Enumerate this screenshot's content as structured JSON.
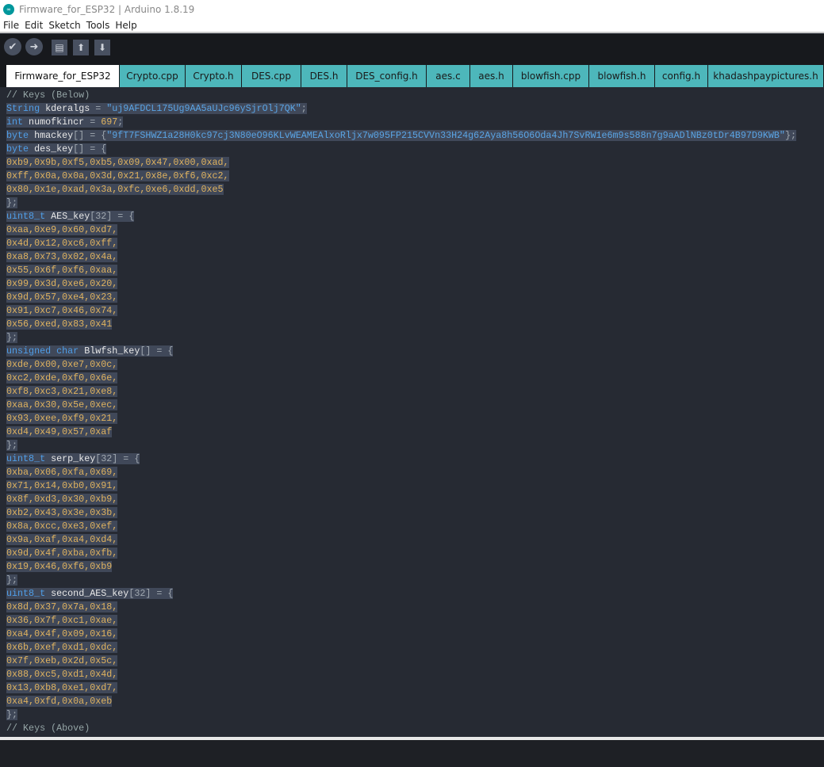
{
  "window": {
    "title": "Firmware_for_ESP32 | Arduino 1.8.19",
    "logo": "arduino-logo"
  },
  "menu": [
    "File",
    "Edit",
    "Sketch",
    "Tools",
    "Help"
  ],
  "toolbar": {
    "verify": "✔",
    "upload": "➜",
    "new": "▤",
    "open": "⬆",
    "save": "⬇"
  },
  "tabs": [
    "Firmware_for_ESP32",
    "Crypto.cpp",
    "Crypto.h",
    "DES.cpp",
    "DES.h",
    "DES_config.h",
    "aes.c",
    "aes.h",
    "blowfish.cpp",
    "blowfish.h",
    "config.h",
    "khadashpaypictures.h"
  ],
  "active_tab": 0,
  "colors": {
    "tab": "#4db7bb",
    "editor_bg": "#262a33",
    "selection": "#404859",
    "keyword": "#4f9ee8",
    "number": "#e0b35f",
    "string": "#5aa5e6"
  },
  "code": [
    {
      "sel": false,
      "t": [
        [
          "cm",
          "// Keys (Below)"
        ]
      ]
    },
    {
      "sel": true,
      "t": [
        [
          "kw",
          "String"
        ],
        [
          "id",
          " kderalgs "
        ],
        [
          "op",
          "= "
        ],
        [
          "str",
          "\"uj9AFDCL175Ug9AA5aUJc96ySjrOlj7QK\""
        ],
        [
          "op",
          ";"
        ]
      ]
    },
    {
      "sel": true,
      "t": [
        [
          "kw",
          "int"
        ],
        [
          "id",
          " numofkincr "
        ],
        [
          "op",
          "= "
        ],
        [
          "num",
          "697"
        ],
        [
          "op",
          ";"
        ]
      ]
    },
    {
      "sel": true,
      "t": [
        [
          "kw",
          "byte"
        ],
        [
          "id",
          " hmackey"
        ],
        [
          "op",
          "[] = {"
        ],
        [
          "str",
          "\"9fT7FSHWZ1a28H0kc97cj3N80eO96KLvWEAMEAlxoRljx7w095FP215CVVn33H24g62Aya8h56O6Oda4Jh7SvRW1e6m9s588n7g9aADlNBz0tDr4B97D9KWB\""
        ],
        [
          "op",
          "};"
        ]
      ]
    },
    {
      "sel": true,
      "t": [
        [
          "kw",
          "byte"
        ],
        [
          "id",
          " des_key"
        ],
        [
          "op",
          "[] = {"
        ]
      ]
    },
    {
      "sel": true,
      "t": [
        [
          "num",
          "0xb9,0x9b,0xf5,0xb5,0x09,0x47,0x00,0xad,"
        ]
      ]
    },
    {
      "sel": true,
      "t": [
        [
          "num",
          "0xff,0x0a,0x0a,0x3d,0x21,0x8e,0xf6,0xc2,"
        ]
      ]
    },
    {
      "sel": true,
      "t": [
        [
          "num",
          "0x80,0x1e,0xad,0x3a,0xfc,0xe6,0xdd,0xe5"
        ]
      ]
    },
    {
      "sel": true,
      "t": [
        [
          "op",
          "};"
        ]
      ]
    },
    {
      "sel": true,
      "t": [
        [
          "kw",
          "uint8_t"
        ],
        [
          "id",
          " AES_key"
        ],
        [
          "op",
          "[32] = {"
        ]
      ]
    },
    {
      "sel": true,
      "t": [
        [
          "num",
          "0xaa,0xe9,0x60,0xd7,"
        ]
      ]
    },
    {
      "sel": true,
      "t": [
        [
          "num",
          "0x4d,0x12,0xc6,0xff,"
        ]
      ]
    },
    {
      "sel": true,
      "t": [
        [
          "num",
          "0xa8,0x73,0x02,0x4a,"
        ]
      ]
    },
    {
      "sel": true,
      "t": [
        [
          "num",
          "0x55,0x6f,0xf6,0xaa,"
        ]
      ]
    },
    {
      "sel": true,
      "t": [
        [
          "num",
          "0x99,0x3d,0xe6,0x20,"
        ]
      ]
    },
    {
      "sel": true,
      "t": [
        [
          "num",
          "0x9d,0x57,0xe4,0x23,"
        ]
      ]
    },
    {
      "sel": true,
      "t": [
        [
          "num",
          "0x91,0xc7,0x46,0x74,"
        ]
      ]
    },
    {
      "sel": true,
      "t": [
        [
          "num",
          "0x56,0xed,0x83,0x41"
        ]
      ]
    },
    {
      "sel": true,
      "t": [
        [
          "op",
          "};"
        ]
      ]
    },
    {
      "sel": true,
      "t": [
        [
          "kw",
          "unsigned char"
        ],
        [
          "id",
          " Blwfsh_key"
        ],
        [
          "op",
          "[] = {"
        ]
      ]
    },
    {
      "sel": true,
      "t": [
        [
          "num",
          "0xde,0x00,0xe7,0x0c,"
        ]
      ]
    },
    {
      "sel": true,
      "t": [
        [
          "num",
          "0xc2,0xde,0xf0,0x6e,"
        ]
      ]
    },
    {
      "sel": true,
      "t": [
        [
          "num",
          "0xf8,0xc3,0x21,0xe8,"
        ]
      ]
    },
    {
      "sel": true,
      "t": [
        [
          "num",
          "0xaa,0x30,0x5e,0xec,"
        ]
      ]
    },
    {
      "sel": true,
      "t": [
        [
          "num",
          "0x93,0xee,0xf9,0x21,"
        ]
      ]
    },
    {
      "sel": true,
      "t": [
        [
          "num",
          "0xd4,0x49,0x57,0xaf"
        ]
      ]
    },
    {
      "sel": true,
      "t": [
        [
          "op",
          "};"
        ]
      ]
    },
    {
      "sel": true,
      "t": [
        [
          "kw",
          "uint8_t"
        ],
        [
          "id",
          " serp_key"
        ],
        [
          "op",
          "[32] = {"
        ]
      ]
    },
    {
      "sel": true,
      "t": [
        [
          "num",
          "0xba,0x06,0xfa,0x69,"
        ]
      ]
    },
    {
      "sel": true,
      "t": [
        [
          "num",
          "0x71,0x14,0xb0,0x91,"
        ]
      ]
    },
    {
      "sel": true,
      "t": [
        [
          "num",
          "0x8f,0xd3,0x30,0xb9,"
        ]
      ]
    },
    {
      "sel": true,
      "t": [
        [
          "num",
          "0xb2,0x43,0x3e,0x3b,"
        ]
      ]
    },
    {
      "sel": true,
      "t": [
        [
          "num",
          "0x8a,0xcc,0xe3,0xef,"
        ]
      ]
    },
    {
      "sel": true,
      "t": [
        [
          "num",
          "0x9a,0xaf,0xa4,0xd4,"
        ]
      ]
    },
    {
      "sel": true,
      "t": [
        [
          "num",
          "0x9d,0x4f,0xba,0xfb,"
        ]
      ]
    },
    {
      "sel": true,
      "t": [
        [
          "num",
          "0x19,0x46,0xf6,0xb9"
        ]
      ]
    },
    {
      "sel": true,
      "t": [
        [
          "op",
          "};"
        ]
      ]
    },
    {
      "sel": true,
      "t": [
        [
          "kw",
          "uint8_t"
        ],
        [
          "id",
          " second_AES_key"
        ],
        [
          "op",
          "[32] = {"
        ]
      ]
    },
    {
      "sel": true,
      "t": [
        [
          "num",
          "0x8d,0x37,0x7a,0x18,"
        ]
      ]
    },
    {
      "sel": true,
      "t": [
        [
          "num",
          "0x36,0x7f,0xc1,0xae,"
        ]
      ]
    },
    {
      "sel": true,
      "t": [
        [
          "num",
          "0xa4,0x4f,0x09,0x16,"
        ]
      ]
    },
    {
      "sel": true,
      "t": [
        [
          "num",
          "0x6b,0xef,0xd1,0xdc,"
        ]
      ]
    },
    {
      "sel": true,
      "t": [
        [
          "num",
          "0x7f,0xeb,0x2d,0x5c,"
        ]
      ]
    },
    {
      "sel": true,
      "t": [
        [
          "num",
          "0x88,0xc5,0xd1,0x4d,"
        ]
      ]
    },
    {
      "sel": true,
      "t": [
        [
          "num",
          "0x13,0xb8,0xe1,0xd7,"
        ]
      ]
    },
    {
      "sel": true,
      "t": [
        [
          "num",
          "0xa4,0xfd,0x0a,0xeb"
        ]
      ]
    },
    {
      "sel": true,
      "t": [
        [
          "op",
          "};"
        ]
      ]
    },
    {
      "sel": false,
      "t": [
        [
          "cm",
          "// Keys (Above)"
        ]
      ]
    }
  ]
}
